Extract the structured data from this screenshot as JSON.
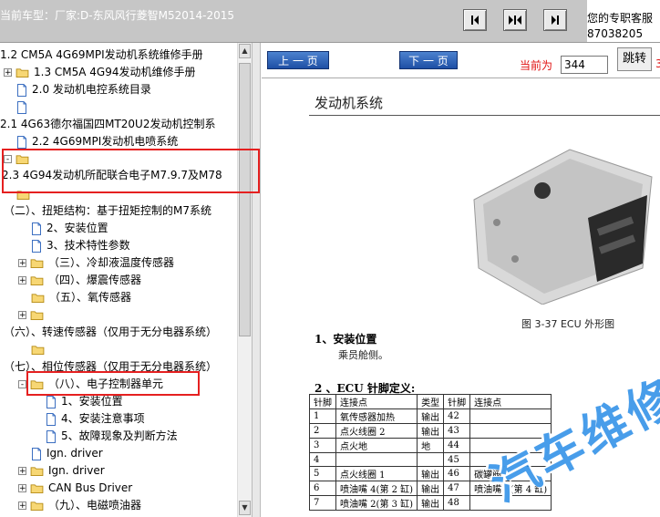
{
  "header": {
    "car_label": "当前车型：厂家:D-东风风行菱智M52014-2015",
    "service_line1": "您的专职客服",
    "service_line2": "87038205"
  },
  "viewer_toolbar": {
    "prev_label": "上 一 页",
    "next_label": "下 一 页",
    "current_page_label": "当前为",
    "current_page_value": "344",
    "jump_label": "跳转",
    "trailing_text": "3"
  },
  "tree": {
    "items": [
      {
        "label": "1.2 CM5A 4G69MPI发动机系统维修手册"
      },
      {
        "label": "1.3 CM5A 4G94发动机维修手册"
      },
      {
        "label": "2.0 发动机电控系统目录"
      },
      {
        "label": ""
      },
      {
        "label": "2.1 4G63德尔福国四MT20U2发动机控制系"
      },
      {
        "label": "2.2 4G69MPI发动机电喷系统"
      },
      {
        "label": ""
      },
      {
        "label": "2.3 4G94发动机所配联合电子M7.9.7及M78"
      },
      {
        "label": ""
      },
      {
        "label": "（二）、扭矩结构：基于扭矩控制的M7系统"
      },
      {
        "label": "2、安装位置"
      },
      {
        "label": "3、技术特性参数"
      },
      {
        "label": "（三）、冷却液温度传感器"
      },
      {
        "label": "（四）、爆震传感器"
      },
      {
        "label": "（五）、氧传感器"
      },
      {
        "label": ""
      },
      {
        "label": "（六）、转速传感器（仅用于无分电器系统）"
      },
      {
        "label": ""
      },
      {
        "label": "（七）、相位传感器（仅用于无分电器系统）"
      },
      {
        "label": "（八）、电子控制器单元"
      },
      {
        "label": "1、安装位置"
      },
      {
        "label": "4、安装注意事项"
      },
      {
        "label": "5、故障现象及判断方法"
      },
      {
        "label": "Ign. driver"
      },
      {
        "label": "Ign. driver"
      },
      {
        "label": "CAN Bus Driver"
      },
      {
        "label": "（九）、电磁喷油器"
      }
    ]
  },
  "document": {
    "title": "发动机系统",
    "figure_caption": "图 3-37   ECU 外形图",
    "section1": "1、安装位置",
    "section1_text": "乘员舱侧。",
    "section2": "2 、ECU 针脚定义:",
    "table_headers": [
      "针脚",
      "连接点",
      "类型",
      "针脚",
      "连接点"
    ],
    "table_rows": [
      [
        "1",
        "氧传感器加热",
        "输出",
        "42",
        ""
      ],
      [
        "2",
        "点火线圈 2",
        "输出",
        "43",
        ""
      ],
      [
        "3",
        "点火地",
        "地",
        "44",
        ""
      ],
      [
        "4",
        "",
        "",
        "45",
        ""
      ],
      [
        "5",
        "点火线圈 1",
        "输出",
        "46",
        "碳罐阀"
      ],
      [
        "6",
        "喷油嘴 4(第 2 缸)",
        "输出",
        "47",
        "喷油嘴 3(第 4 缸)"
      ],
      [
        "7",
        "喷油嘴 2(第 3 缸)",
        "输出",
        "48",
        ""
      ]
    ],
    "watermark": "汽车维修"
  },
  "colors": {
    "highlight": "#e52020",
    "toolbar_bg": "#c6c6c6",
    "page_button": "#2a5db5",
    "page_label": "#e01010"
  }
}
